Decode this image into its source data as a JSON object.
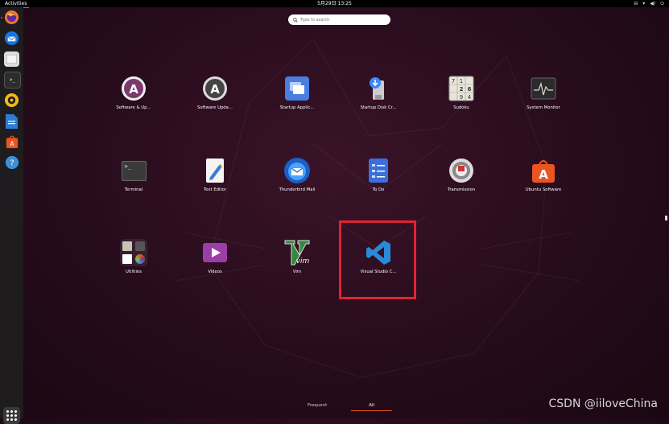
{
  "topbar": {
    "activities": "Activities",
    "clock": "5月29日  13:25",
    "tray": [
      "⊟",
      "▾",
      "◀)",
      "⏻"
    ]
  },
  "search": {
    "placeholder": "Type to search"
  },
  "dock": {
    "items": [
      {
        "name": "firefox"
      },
      {
        "name": "thunderbird"
      },
      {
        "name": "files"
      },
      {
        "name": "terminal"
      },
      {
        "name": "rhythmbox"
      },
      {
        "name": "libreoffice-writer"
      },
      {
        "name": "ubuntu-software"
      },
      {
        "name": "help"
      }
    ]
  },
  "apps": [
    {
      "label": "Software & Up...",
      "icon": "software-updater-icon"
    },
    {
      "label": "Software Upda...",
      "icon": "software-update-icon"
    },
    {
      "label": "Startup Applic...",
      "icon": "startup-applications-icon"
    },
    {
      "label": "Startup Disk Cr...",
      "icon": "startup-disk-creator-icon"
    },
    {
      "label": "Sudoku",
      "icon": "sudoku-icon"
    },
    {
      "label": "System Monitor",
      "icon": "system-monitor-icon"
    },
    {
      "label": "Terminal",
      "icon": "terminal-icon"
    },
    {
      "label": "Text Editor",
      "icon": "text-editor-icon"
    },
    {
      "label": "Thunderbird Mail",
      "icon": "thunderbird-icon"
    },
    {
      "label": "To Do",
      "icon": "todo-icon"
    },
    {
      "label": "Transmission",
      "icon": "transmission-icon"
    },
    {
      "label": "Ubuntu Software",
      "icon": "ubuntu-software-icon"
    },
    {
      "label": "Utilities",
      "icon": "utilities-folder-icon"
    },
    {
      "label": "Videos",
      "icon": "videos-icon"
    },
    {
      "label": "Vim",
      "icon": "vim-icon"
    },
    {
      "label": "Visual Studio C...",
      "icon": "vscode-icon"
    }
  ],
  "sudoku_digits": [
    "7",
    "1",
    "",
    "",
    "2",
    "6",
    "",
    "9",
    "4"
  ],
  "terminal_prompt": ">_",
  "vim_text": "vim",
  "tabs": {
    "frequent": "Frequent",
    "all": "All"
  },
  "watermark": "CSDN @iiloveChina",
  "colors": {
    "accent": "#e95420",
    "highlight": "#e02430",
    "vscode": "#2a8ad8"
  }
}
